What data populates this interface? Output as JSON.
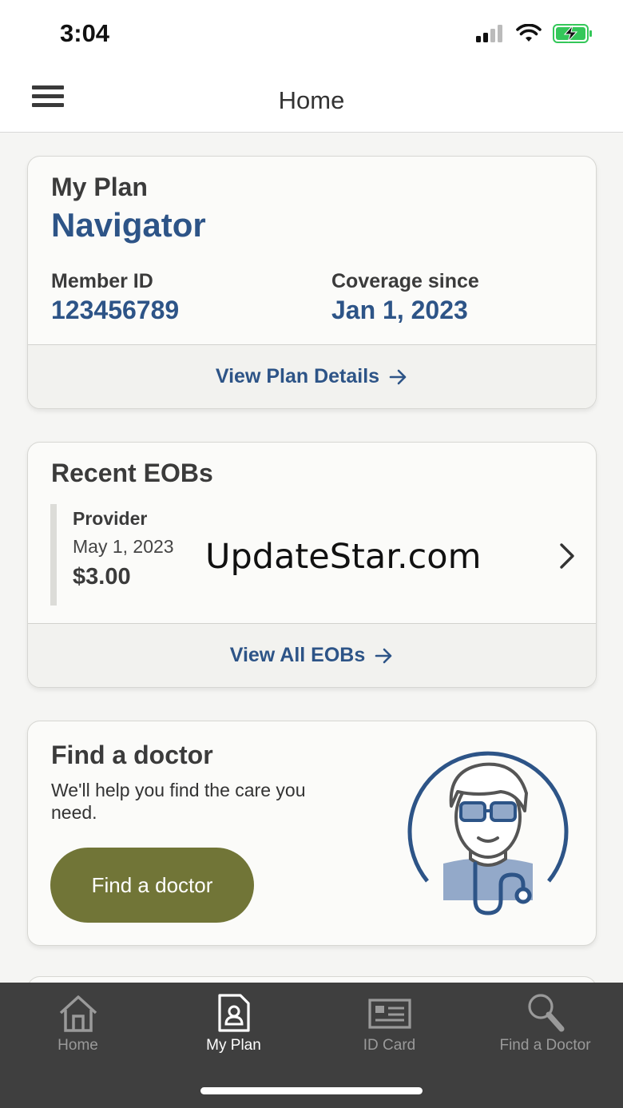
{
  "status_bar": {
    "time": "3:04",
    "icons": [
      "signal-icon",
      "wifi-icon",
      "battery-charging-icon"
    ]
  },
  "header": {
    "title": "Home",
    "menu_icon": "hamburger-menu-icon"
  },
  "plan_card": {
    "label": "My Plan",
    "plan_name": "Navigator",
    "member_id_label": "Member ID",
    "member_id": "123456789",
    "coverage_label": "Coverage since",
    "coverage_date": "Jan 1, 2023",
    "footer_link": "View Plan Details"
  },
  "eob_card": {
    "title": "Recent EOBs",
    "items": [
      {
        "provider": "Provider",
        "date": "May 1, 2023",
        "amount": "$3.00"
      }
    ],
    "watermark": "UpdateStar.com",
    "footer_link": "View All EOBs"
  },
  "doctor_card": {
    "title": "Find a doctor",
    "description": "We'll help you find the care you need.",
    "button_label": "Find a doctor",
    "illustration": "doctor-illustration"
  },
  "tab_bar": {
    "tabs": [
      {
        "label": "Home",
        "icon": "home-icon",
        "active": false
      },
      {
        "label": "My Plan",
        "icon": "my-plan-icon",
        "active": true
      },
      {
        "label": "ID Card",
        "icon": "id-card-icon",
        "active": false
      },
      {
        "label": "Find a Doctor",
        "icon": "search-icon",
        "active": false
      }
    ]
  },
  "colors": {
    "brand_blue": "#2d5487",
    "button_olive": "#717537",
    "tab_bar_bg": "#3f3f3f"
  }
}
